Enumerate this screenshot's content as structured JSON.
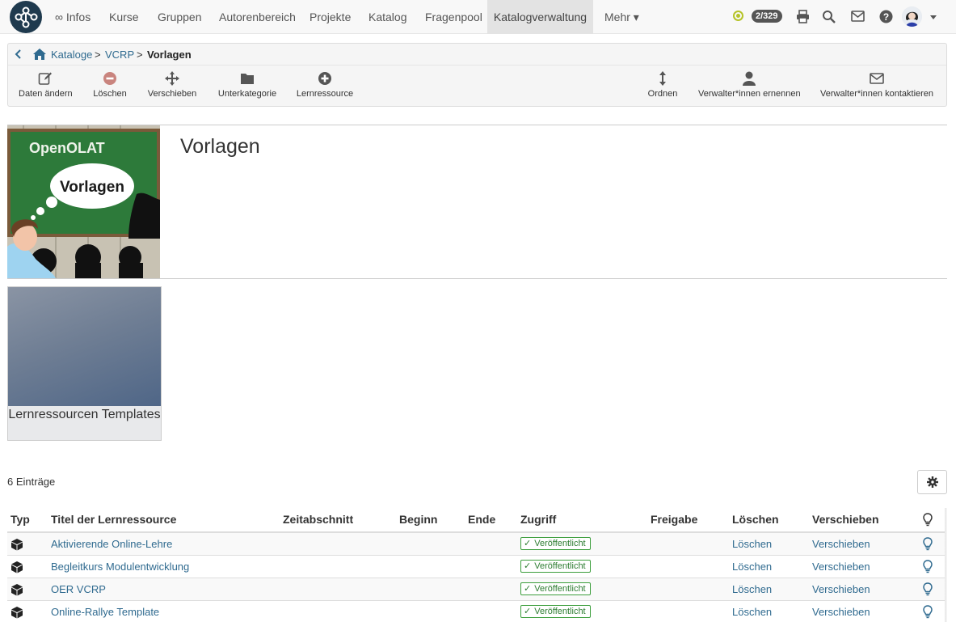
{
  "navbar": {
    "logo": "openolat-logo",
    "items": [
      {
        "label": "∞ Infos",
        "active": false
      },
      {
        "label": "Kurse",
        "active": false
      },
      {
        "label": "Gruppen",
        "active": false
      },
      {
        "label": "Autorenbereich",
        "active": false
      },
      {
        "label": "Projekte",
        "active": false
      },
      {
        "label": "Katalog",
        "active": false
      },
      {
        "label": "Fragenpool",
        "active": false
      },
      {
        "label": "Katalogverwaltung",
        "active": true
      },
      {
        "label": "Mehr ▾",
        "active": false
      }
    ],
    "badge": "2/329",
    "icons": [
      "status-icon",
      "print-icon",
      "search-icon",
      "mail-icon",
      "help-icon",
      "user-avatar",
      "caret-down-icon"
    ]
  },
  "breadcrumb": {
    "back_icon": "chevron-left-icon",
    "home_icon": "home-icon",
    "items": [
      "Kataloge",
      "VCRP",
      "Vorlagen"
    ],
    "separator": ">"
  },
  "toolbar": {
    "edit": "Daten ändern",
    "delete": "Löschen",
    "move": "Verschieben",
    "subcategory": "Unterkategorie",
    "resource": "Lernressource",
    "order": "Ordnen",
    "appoint": "Verwalter*innen ernennen",
    "contact": "Verwalter*innen kontaktieren"
  },
  "header": {
    "title": "Vorlagen",
    "image_caption": {
      "brand": "OpenOLAT",
      "bubble": "Vorlagen"
    }
  },
  "subcategory_tile": {
    "label": "Lernressourcen Templates"
  },
  "table": {
    "count": "6 Einträge",
    "settings_icon": "gear-icon",
    "columns": [
      "Typ",
      "Titel der Lernressource",
      "Zeitabschnitt",
      "Beginn",
      "Ende",
      "Zugriff",
      "Freigabe",
      "Löschen",
      "Verschieben"
    ],
    "rows": [
      {
        "title": "Aktivierende Online-Lehre",
        "access": "Veröffentlicht",
        "delete": "Löschen",
        "move": "Verschieben"
      },
      {
        "title": "Begleitkurs Modulentwicklung",
        "access": "Veröffentlicht",
        "delete": "Löschen",
        "move": "Verschieben"
      },
      {
        "title": "OER VCRP",
        "access": "Veröffentlicht",
        "delete": "Löschen",
        "move": "Verschieben"
      },
      {
        "title": "Online-Rallye Template",
        "access": "Veröffentlicht",
        "delete": "Löschen",
        "move": "Verschieben"
      }
    ],
    "colors": {
      "link": "#2f6a8f",
      "published": "#2e7d32"
    }
  }
}
